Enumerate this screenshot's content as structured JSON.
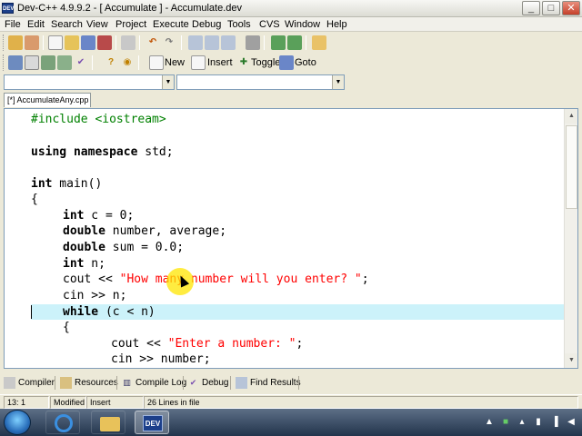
{
  "window": {
    "title": "Dev-C++ 4.9.9.2  - [ Accumulate ] - Accumulate.dev",
    "app_icon": "DEV",
    "minimize": "_",
    "maximize": "□",
    "close": "✕"
  },
  "menubar": {
    "items": [
      "File",
      "Edit",
      "Search",
      "View",
      "Project",
      "Execute",
      "Debug",
      "Tools",
      "CVS",
      "Window",
      "Help"
    ]
  },
  "toolbar2": {
    "new_label": "New",
    "insert_label": "Insert",
    "toggle_label": "Toggle",
    "goto_label": "Goto"
  },
  "combos": {
    "class_value": "",
    "member_value": ""
  },
  "editor_tab": {
    "label": "[*] AccumulateAny.cpp"
  },
  "code": {
    "l1": "#include <iostream>",
    "l3_kw1": "using",
    "l3_kw2": "namespace",
    "l3_rest": " std;",
    "l5_kw": "int",
    "l5_rest": " main()",
    "l6": "{",
    "l7_kw": "int",
    "l7_a": " c = ",
    "l7_num": "0",
    "l7_b": ";",
    "l8_kw": "double",
    "l8_rest": " number, average;",
    "l9_kw": "double",
    "l9_a": " sum = ",
    "l9_num": "0.0",
    "l9_b": ";",
    "l10_kw": "int",
    "l10_rest": " n;",
    "l11_a": "cout << ",
    "l11_str": "\"How many number will you enter? \"",
    "l11_b": ";",
    "l12": "cin >> n;",
    "l13_kw": "while",
    "l13_rest": " (c < n)",
    "l14": "{",
    "l15_a": "cout << ",
    "l15_str": "\"Enter a number: \"",
    "l15_b": ";",
    "l16": "cin >> number;"
  },
  "bottom_tabs": {
    "compiler": "Compiler",
    "resources": "Resources",
    "compile_log": "Compile Log",
    "debug": "Debug",
    "find_results": "Find Results"
  },
  "status": {
    "position": "13: 1",
    "modified": "Modified",
    "mode": "Insert",
    "lines": "26 Lines in file"
  },
  "taskbar": {
    "dev_app_label": "DEV"
  },
  "colors": {
    "highlight_line": "#ccf2fa",
    "string": "#ff0000",
    "preprocessor": "#008000",
    "cursor_ring": "#ffe600"
  }
}
